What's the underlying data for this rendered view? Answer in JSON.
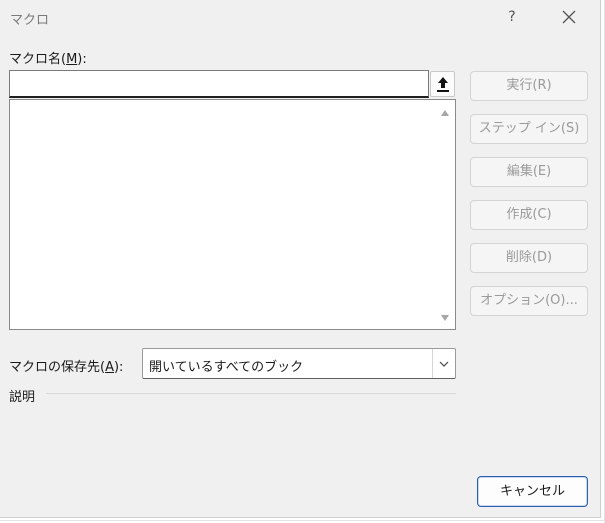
{
  "window": {
    "title": "マクロ",
    "help_glyph": "?",
    "close_icon": "close-icon"
  },
  "macro_name": {
    "label_prefix": "マクロ名(",
    "accel": "M",
    "label_suffix": "):",
    "value": "",
    "placeholder": ""
  },
  "macro_list": {
    "items": []
  },
  "buttons": {
    "run": "実行(R)",
    "step_in": "ステップ イン(S)",
    "edit": "編集(E)",
    "create": "作成(C)",
    "delete": "削除(D)",
    "options": "オプション(O)...",
    "cancel": "キャンセル"
  },
  "macros_in": {
    "label_prefix": "マクロの保存先(",
    "accel": "A",
    "label_suffix": "):",
    "selected": "開いているすべてのブック"
  },
  "description": {
    "label": "説明"
  },
  "colors": {
    "dialog_bg": "#f0f0f0",
    "disabled_text": "#9a9a9a",
    "default_button_border": "#2b5fb0"
  }
}
